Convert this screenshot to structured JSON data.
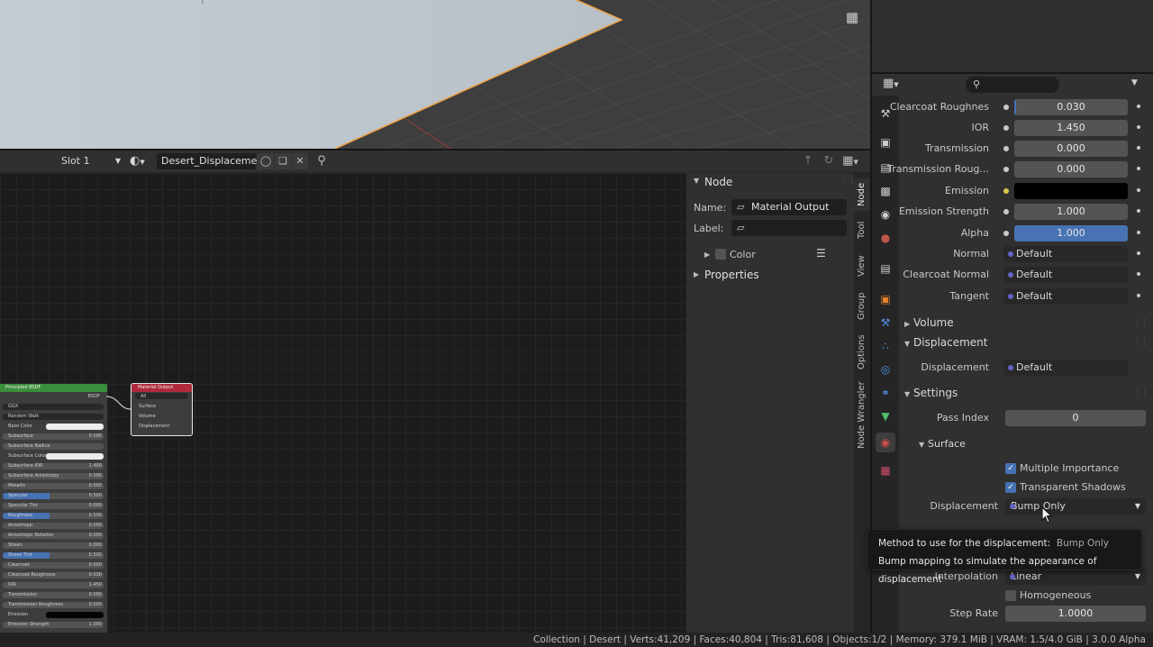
{
  "node_header": {
    "slot": "Slot 1",
    "material_name": "Desert_Displacement"
  },
  "node_editor": {
    "bsdf_node": {
      "title": "Principled BSDF",
      "output": "BSDF",
      "distribution": "GGX",
      "subsurface_method": "Random Walk",
      "rows": [
        {
          "label": "Base Color",
          "value": "",
          "type": "color"
        },
        {
          "label": "Subsurface",
          "value": "0.000",
          "type": "num"
        },
        {
          "label": "Subsurface Radius",
          "value": "",
          "type": "vec"
        },
        {
          "label": "Subsurface Color",
          "value": "",
          "type": "color"
        },
        {
          "label": "Subsurface IOR",
          "value": "1.400",
          "type": "num"
        },
        {
          "label": "Subsurface Anisotropy",
          "value": "0.000",
          "type": "num"
        },
        {
          "label": "Metallic",
          "value": "0.000",
          "type": "num"
        },
        {
          "label": "Specular",
          "value": "0.500",
          "type": "fill"
        },
        {
          "label": "Specular Tint",
          "value": "0.000",
          "type": "num"
        },
        {
          "label": "Roughness",
          "value": "0.500",
          "type": "fill"
        },
        {
          "label": "Anisotropic",
          "value": "0.000",
          "type": "num"
        },
        {
          "label": "Anisotropic Rotation",
          "value": "0.000",
          "type": "num"
        },
        {
          "label": "Sheen",
          "value": "0.000",
          "type": "num"
        },
        {
          "label": "Sheen Tint",
          "value": "0.500",
          "type": "fill"
        },
        {
          "label": "Clearcoat",
          "value": "0.000",
          "type": "num"
        },
        {
          "label": "Clearcoat Roughness",
          "value": "0.030",
          "type": "num"
        },
        {
          "label": "IOR",
          "value": "1.450",
          "type": "num"
        },
        {
          "label": "Transmission",
          "value": "0.000",
          "type": "num"
        },
        {
          "label": "Transmission Roughness",
          "value": "0.000",
          "type": "num"
        },
        {
          "label": "Emission",
          "value": "",
          "type": "black"
        },
        {
          "label": "Emission Strength",
          "value": "1.000",
          "type": "num"
        }
      ]
    },
    "output_node": {
      "title": "Material Output",
      "target": "All",
      "inputs": [
        "Surface",
        "Volume",
        "Displacement"
      ]
    }
  },
  "n_panel": {
    "section": "Node",
    "name_label": "Name:",
    "name_value": "Material Output",
    "label_label": "Label:",
    "label_value": "",
    "color_label": "Color",
    "properties_label": "Properties",
    "tabs": [
      "Node",
      "Tool",
      "View",
      "Group",
      "Options",
      "Node Wrangler"
    ]
  },
  "properties": {
    "rows": [
      {
        "label": "Clearcoat Roughnes",
        "value": "0.030",
        "kind": "slider"
      },
      {
        "label": "IOR",
        "value": "1.450",
        "kind": "num"
      },
      {
        "label": "Transmission",
        "value": "0.000",
        "kind": "num"
      },
      {
        "label": "Transmission Roug...",
        "value": "0.000",
        "kind": "num"
      },
      {
        "label": "Emission",
        "value": "",
        "kind": "black"
      },
      {
        "label": "Emission Strength",
        "value": "1.000",
        "kind": "num"
      },
      {
        "label": "Alpha",
        "value": "1.000",
        "kind": "blue"
      },
      {
        "label": "Normal",
        "value": "Default",
        "kind": "socket"
      },
      {
        "label": "Clearcoat Normal",
        "value": "Default",
        "kind": "socket"
      },
      {
        "label": "Tangent",
        "value": "Default",
        "kind": "socket"
      }
    ],
    "sections": {
      "volume": "Volume",
      "displacement": "Displacement",
      "settings": "Settings",
      "surface": "Surface"
    },
    "displacement_row": {
      "label": "Displacement",
      "value": "Default"
    },
    "pass_index": {
      "label": "Pass Index",
      "value": "0"
    },
    "multiple_importance": "Multiple Importance",
    "transparent_shadows": "Transparent Shadows",
    "displacement_method": {
      "label": "Displacement",
      "value": "Bump Only"
    },
    "interpolation": {
      "label": "Interpolation",
      "value": "Linear"
    },
    "homogeneous": "Homogeneous",
    "step_rate": {
      "label": "Step Rate",
      "value": "1.0000"
    }
  },
  "tooltip": {
    "line1": "Method to use for the displacement:",
    "line1_value": "Bump Only",
    "line2": "Bump mapping to simulate the appearance of displacement"
  },
  "status_bar": "Collection | Desert | Verts:41,209 | Faces:40,804 | Tris:81,608 | Objects:1/2 | Memory: 379.1 MiB | VRAM: 1.5/4.0 GiB | 3.0.0 Alpha",
  "colors": {
    "accent": "#4772b3",
    "selection_outline": "#f0a040",
    "bsdf_header": "#3b8e3b",
    "output_header": "#b02a3c"
  }
}
